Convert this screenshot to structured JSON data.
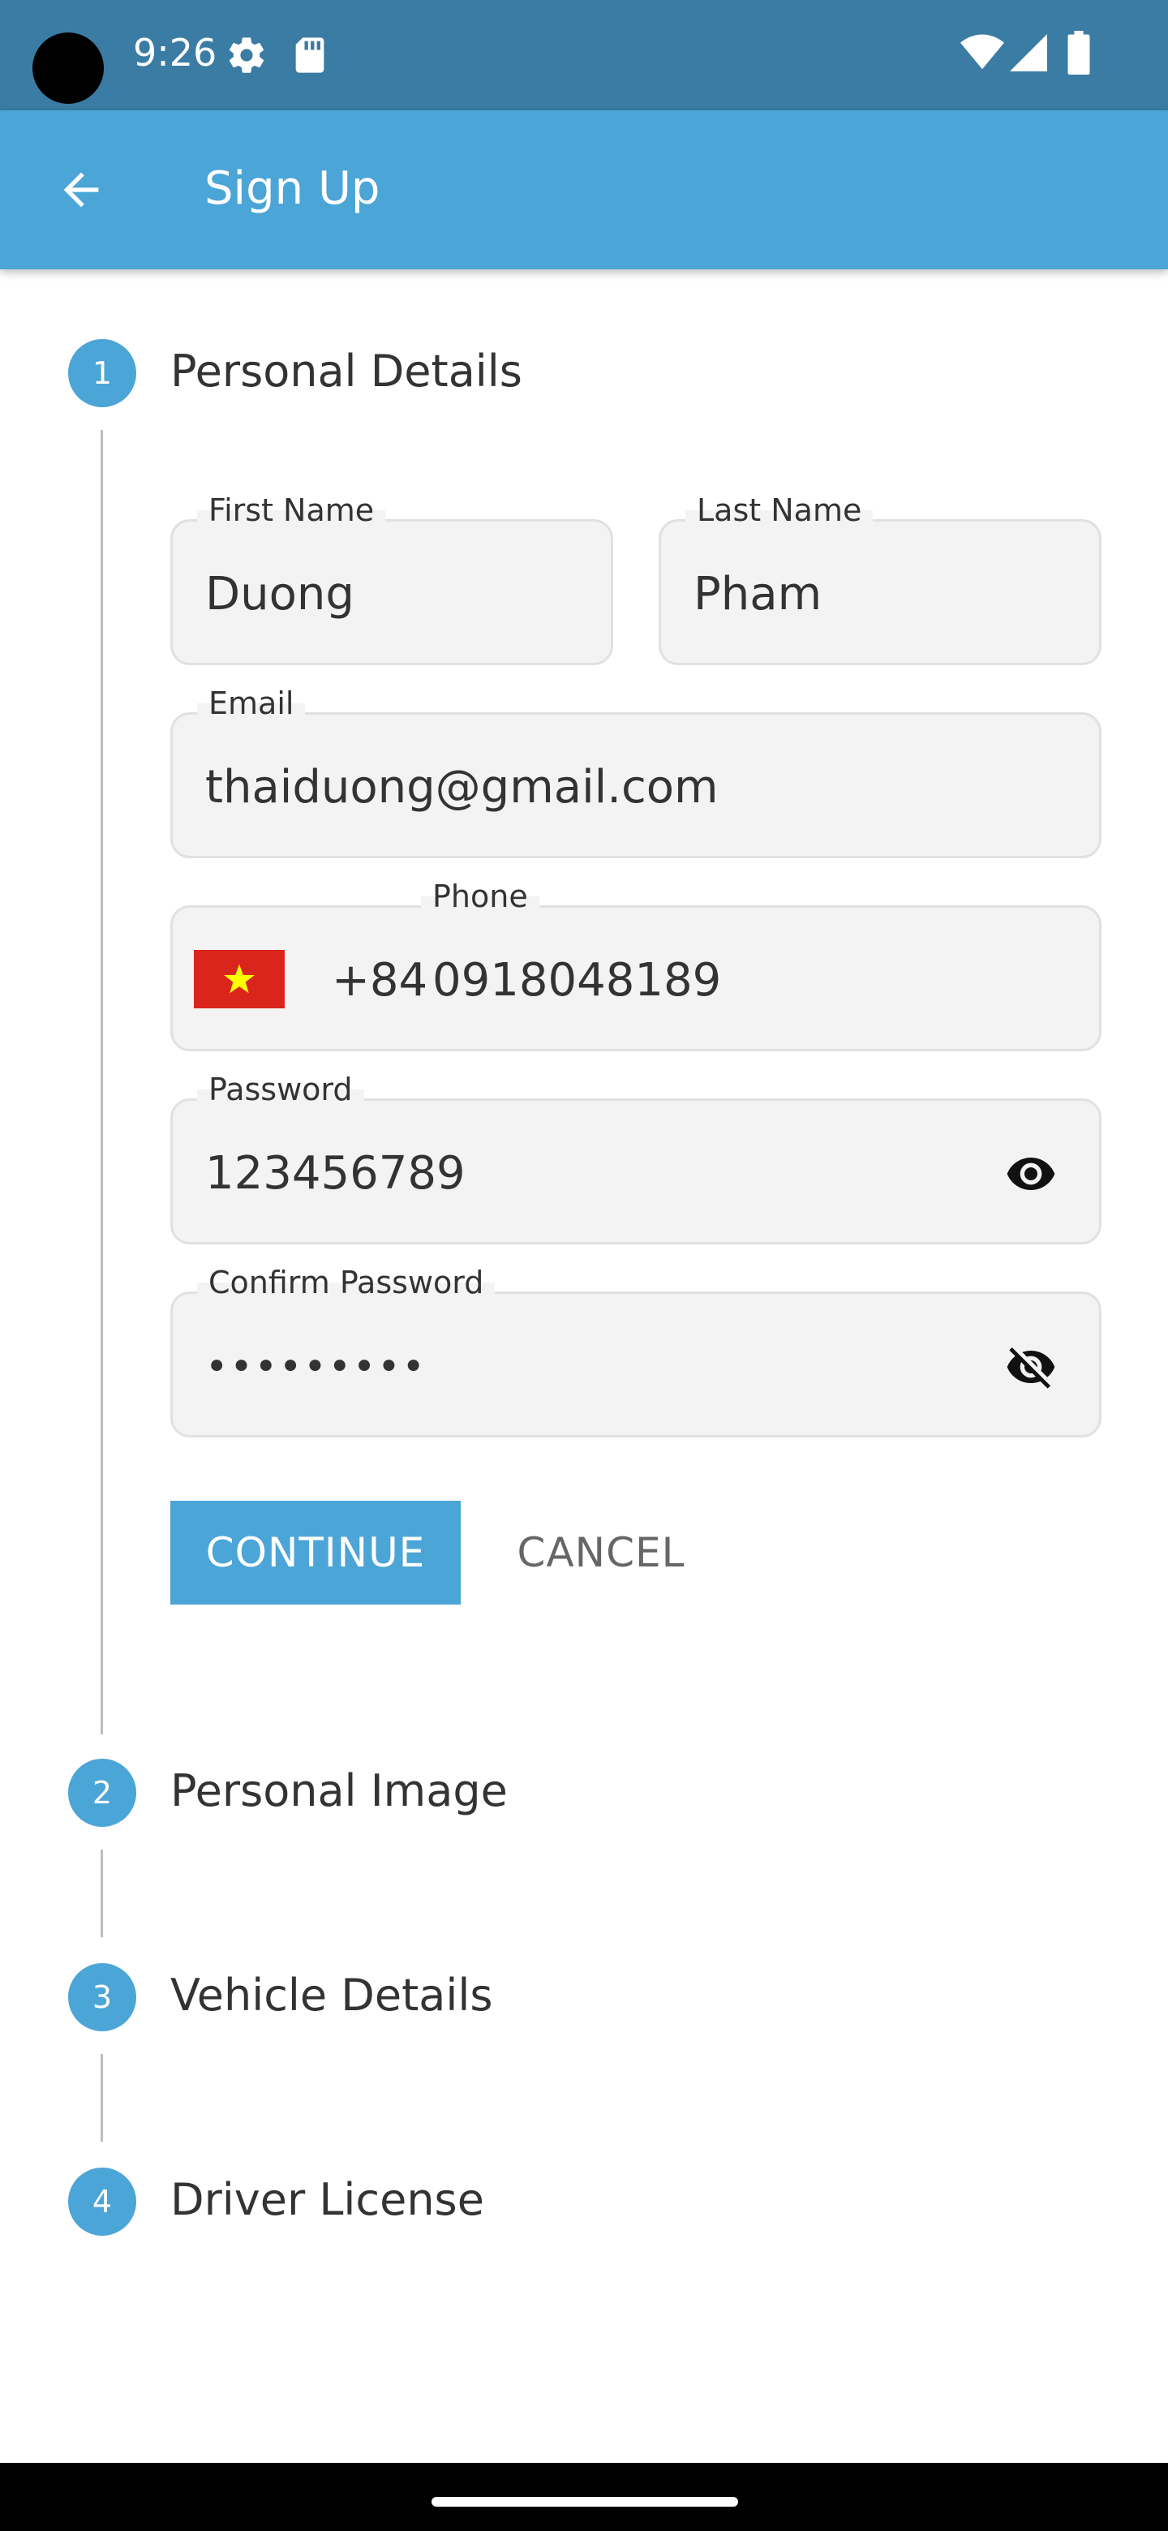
{
  "status_bar": {
    "time": "9:26",
    "icons": [
      "settings-icon",
      "sd-card-icon",
      "wifi-icon",
      "signal-icon",
      "battery-icon"
    ]
  },
  "app_bar": {
    "title": "Sign Up",
    "back_icon": "arrow-back-icon"
  },
  "stepper": {
    "steps": [
      {
        "number": "1",
        "label": "Personal Details"
      },
      {
        "number": "2",
        "label": "Personal Image"
      },
      {
        "number": "3",
        "label": "Vehicle Details"
      },
      {
        "number": "4",
        "label": "Driver License"
      }
    ]
  },
  "form": {
    "first_name": {
      "label": "First Name",
      "value": "Duong"
    },
    "last_name": {
      "label": "Last Name",
      "value": "Pham"
    },
    "email": {
      "label": "Email",
      "value": "thaiduong@gmail.com"
    },
    "phone": {
      "label": "Phone",
      "country_flag": "vietnam-flag-icon",
      "dial_code": "+84",
      "value": "0918048189"
    },
    "password": {
      "label": "Password",
      "value": "123456789",
      "toggle_icon": "eye-icon"
    },
    "confirm_password": {
      "label": "Confirm Password",
      "value": "•••••••••",
      "toggle_icon": "eye-off-icon"
    }
  },
  "actions": {
    "continue_label": "CONTINUE",
    "cancel_label": "CANCEL"
  },
  "colors": {
    "status_bar": "#3a7ca4",
    "primary": "#4ca5d7",
    "field_bg": "#f3f3f3",
    "field_border": "#e1e1e1"
  }
}
